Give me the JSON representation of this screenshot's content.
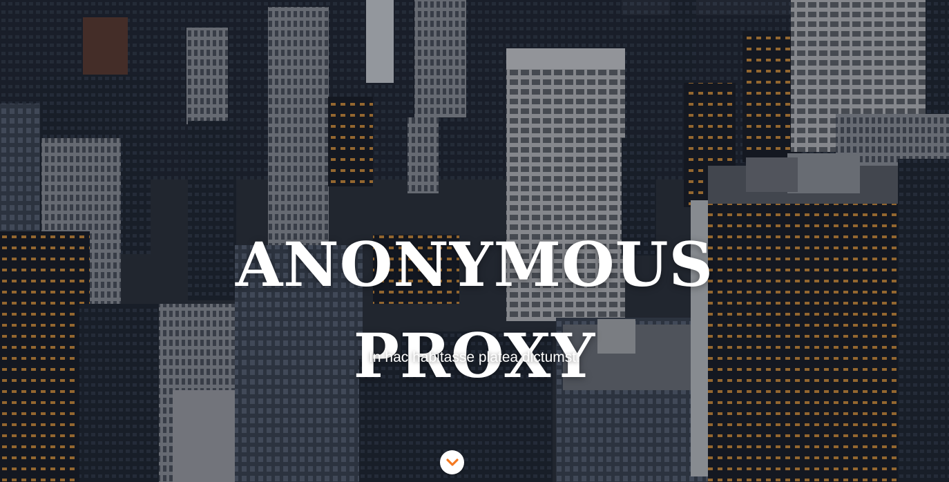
{
  "hero": {
    "title_line1": "ANONYMOUS",
    "title_line2": "PROXY",
    "subtitle": "In hac habitasse platea dictumst.",
    "scroll_icon": "chevron-down-icon",
    "accent_color": "#f47920",
    "text_color": "#ffffff"
  }
}
